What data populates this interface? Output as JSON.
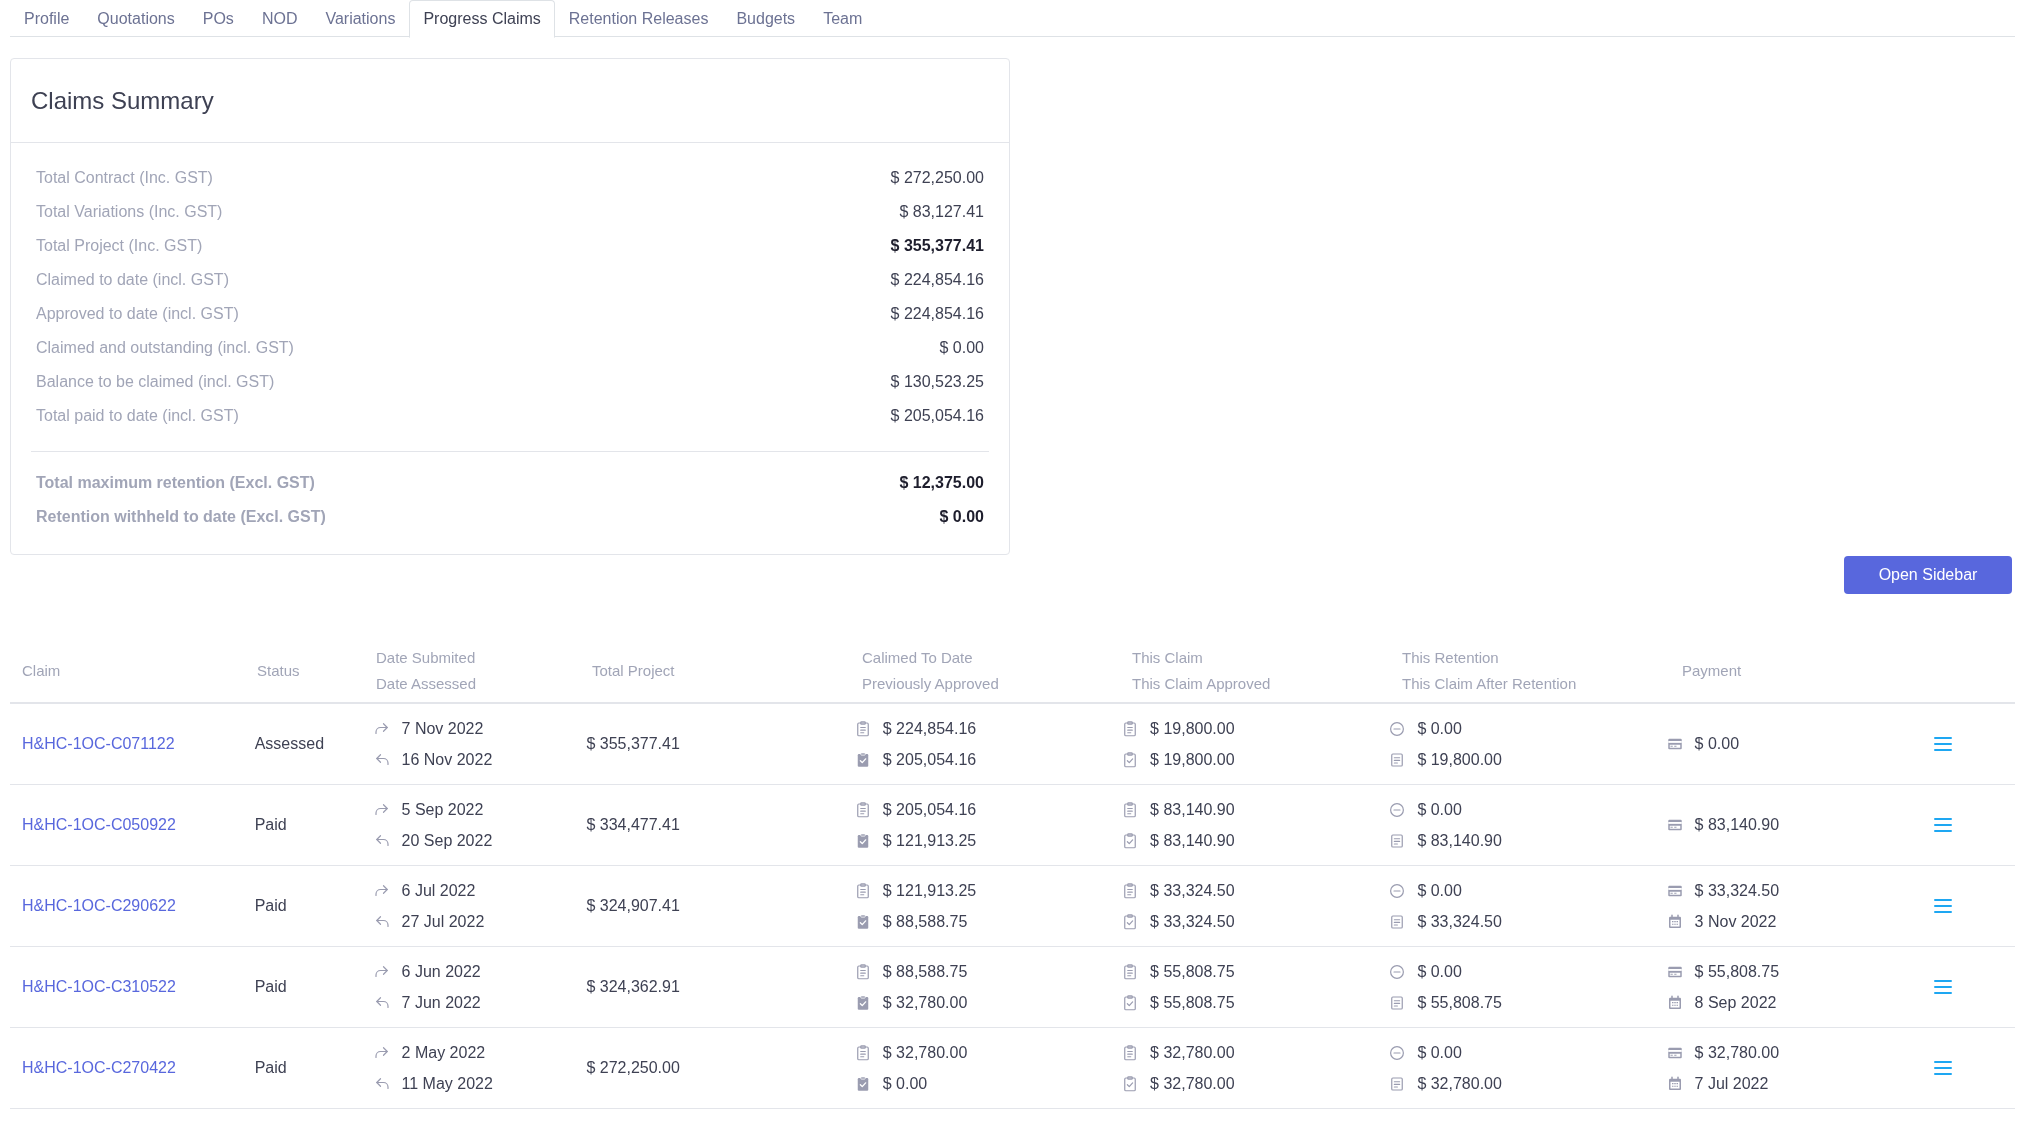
{
  "tabs": [
    {
      "label": "Profile",
      "selected": false
    },
    {
      "label": "Quotations",
      "selected": false
    },
    {
      "label": "POs",
      "selected": false
    },
    {
      "label": "NOD",
      "selected": false
    },
    {
      "label": "Variations",
      "selected": false
    },
    {
      "label": "Progress Claims",
      "selected": true
    },
    {
      "label": "Retention Releases",
      "selected": false
    },
    {
      "label": "Budgets",
      "selected": false
    },
    {
      "label": "Team",
      "selected": false
    }
  ],
  "summary": {
    "title": "Claims Summary",
    "rows": [
      {
        "label": "Total Contract (Inc. GST)",
        "value": "$ 272,250.00",
        "kind": "normal"
      },
      {
        "label": "Total Variations (Inc. GST)",
        "value": "$ 83,127.41",
        "kind": "normal"
      },
      {
        "label": "Total Project (Inc. GST)",
        "value": "$ 355,377.41",
        "kind": "total"
      },
      {
        "label": "Claimed to date (incl. GST)",
        "value": "$ 224,854.16",
        "kind": "normal"
      },
      {
        "label": "Approved to date (incl. GST)",
        "value": "$ 224,854.16",
        "kind": "normal"
      },
      {
        "label": "Claimed and outstanding (incl. GST)",
        "value": "$ 0.00",
        "kind": "normal"
      },
      {
        "label": "Balance to be claimed (incl. GST)",
        "value": "$ 130,523.25",
        "kind": "normal"
      },
      {
        "label": "Total paid to date (incl. GST)",
        "value": "$ 205,054.16",
        "kind": "normal"
      }
    ],
    "retention_rows": [
      {
        "label": "Total maximum retention (Excl. GST)",
        "value": "$ 12,375.00"
      },
      {
        "label": "Retention withheld to date (Excl. GST)",
        "value": "$ 0.00"
      }
    ]
  },
  "open_sidebar_button": "Open Sidebar",
  "table": {
    "columns": [
      [
        "Claim"
      ],
      [
        "Status"
      ],
      [
        "Date Submited",
        "Date Assessed"
      ],
      [
        "Total Project"
      ],
      [
        "Calimed To Date",
        "Previously Approved"
      ],
      [
        "This Claim",
        "This Claim Approved"
      ],
      [
        "This Retention",
        "This Claim After Retention"
      ],
      [
        "Payment"
      ]
    ],
    "rows": [
      {
        "claim": "H&HC-1OC-C071122",
        "status": "Assessed",
        "submitted": "7 Nov 2022",
        "assessed": "16 Nov 2022",
        "total": "$ 355,377.41",
        "claimed_to_date": "$ 224,854.16",
        "previously_approved": "$ 205,054.16",
        "this_claim": "$ 19,800.00",
        "this_claim_approved": "$ 19,800.00",
        "this_retention": "$ 0.00",
        "after_retention": "$ 19,800.00",
        "payment": "$ 0.00"
      },
      {
        "claim": "H&HC-1OC-C050922",
        "status": "Paid",
        "submitted": "5 Sep 2022",
        "assessed": "20 Sep 2022",
        "total": "$ 334,477.41",
        "claimed_to_date": "$ 205,054.16",
        "previously_approved": "$ 121,913.25",
        "this_claim": "$ 83,140.90",
        "this_claim_approved": "$ 83,140.90",
        "this_retention": "$ 0.00",
        "after_retention": "$ 83,140.90",
        "payment": "$ 83,140.90"
      },
      {
        "claim": "H&HC-1OC-C290622",
        "status": "Paid",
        "submitted": "6 Jul 2022",
        "assessed": "27 Jul 2022",
        "total": "$ 324,907.41",
        "claimed_to_date": "$ 121,913.25",
        "previously_approved": "$ 88,588.75",
        "this_claim": "$ 33,324.50",
        "this_claim_approved": "$ 33,324.50",
        "this_retention": "$ 0.00",
        "after_retention": "$ 33,324.50",
        "payment": "$ 33,324.50",
        "payment_date": "3 Nov 2022"
      },
      {
        "claim": "H&HC-1OC-C310522",
        "status": "Paid",
        "submitted": "6 Jun 2022",
        "assessed": "7 Jun 2022",
        "total": "$ 324,362.91",
        "claimed_to_date": "$ 88,588.75",
        "previously_approved": "$ 32,780.00",
        "this_claim": "$ 55,808.75",
        "this_claim_approved": "$ 55,808.75",
        "this_retention": "$ 0.00",
        "after_retention": "$ 55,808.75",
        "payment": "$ 55,808.75",
        "payment_date": "8 Sep 2022"
      },
      {
        "claim": "H&HC-1OC-C270422",
        "status": "Paid",
        "submitted": "2 May 2022",
        "assessed": "11 May 2022",
        "total": "$ 272,250.00",
        "claimed_to_date": "$ 32,780.00",
        "previously_approved": "$ 0.00",
        "this_claim": "$ 32,780.00",
        "this_claim_approved": "$ 32,780.00",
        "this_retention": "$ 0.00",
        "after_retention": "$ 32,780.00",
        "payment": "$ 32,780.00",
        "payment_date": "7 Jul 2022"
      }
    ]
  }
}
